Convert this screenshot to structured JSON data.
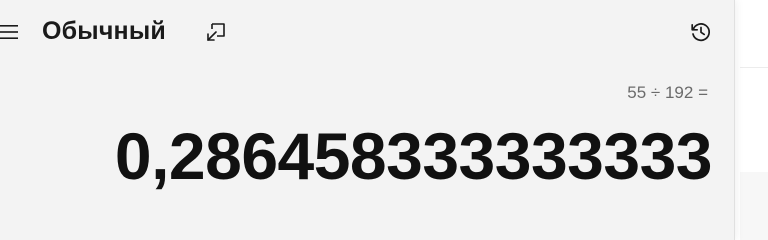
{
  "header": {
    "mode_title": "Обычный"
  },
  "icons": {
    "menu": "hamburger-menu-icon",
    "keep_on_top": "keep-on-top-icon",
    "history": "history-icon"
  },
  "display": {
    "expression": "55 ÷ 192 =",
    "result": "0,286458333333333"
  },
  "colors": {
    "window_background": "#f3f3f3",
    "text_primary": "#111111",
    "text_secondary": "#6b6b6b"
  }
}
